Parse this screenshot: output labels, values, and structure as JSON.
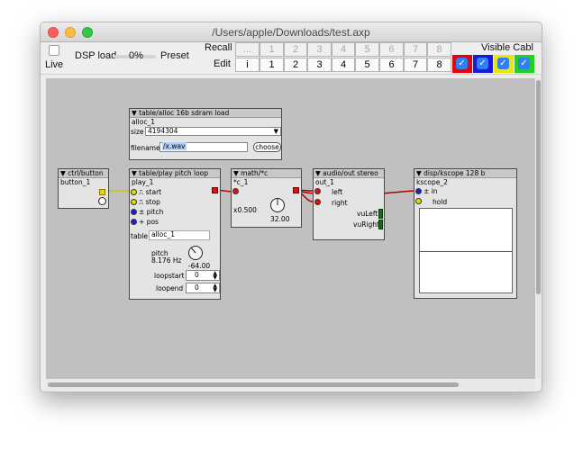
{
  "window": {
    "title": "/Users/apple/Downloads/test.axp",
    "traffic_lights": {
      "close": "#fc605c",
      "minimize": "#fdbc40",
      "zoom": "#34c84a"
    }
  },
  "toolbar": {
    "live_label": "Live",
    "dsp_label": "DSP load",
    "dsp_value": "0%",
    "preset_label": "Preset",
    "recall_label": "Recall",
    "edit_label": "Edit",
    "recall_buttons": [
      "...",
      "1",
      "2",
      "3",
      "4",
      "5",
      "6",
      "7",
      "8"
    ],
    "edit_buttons": [
      "i",
      "1",
      "2",
      "3",
      "4",
      "5",
      "6",
      "7",
      "8"
    ],
    "visible_label": "Visible Cabl",
    "visible_colors": [
      "#e8000b",
      "#1a1ad8",
      "#e8e800",
      "#1ed21e"
    ]
  },
  "objects": {
    "table_alloc": {
      "header": "▼ table/alloc 16b sdram load",
      "name": "alloc_1",
      "size_label": "size",
      "size_value": "4194304",
      "filename_label": "filename",
      "filename_value": "/x.wav",
      "choose_label": "choose"
    },
    "button": {
      "header": "▼ ctrl/button",
      "name": "button_1"
    },
    "play": {
      "header": "▼ table/play pitch loop",
      "name": "play_1",
      "inputs": [
        "start",
        "stop",
        "pitch",
        "pos"
      ],
      "table_label": "table",
      "table_value": "alloc_1",
      "pitch_label": "pitch",
      "pitch_value": "8.176 Hz",
      "knob_value": "-64.00",
      "loopstart_label": "loopstart",
      "loopstart_value": "0",
      "loopend_label": "loopend",
      "loopend_value": "0"
    },
    "math": {
      "header": "▼ math/*c",
      "name": "*c_1",
      "mult": "x0.500",
      "knob_value": "32.00"
    },
    "audio": {
      "header": "▼ audio/out stereo",
      "name": "out_1",
      "left": "left",
      "right": "right",
      "vu_left": "vuLeft",
      "vu_right": "vuRight"
    },
    "kscope": {
      "header": "▼ disp/kscope 128 b",
      "name": "kscope_2",
      "in": "in",
      "hold": "hold"
    }
  }
}
